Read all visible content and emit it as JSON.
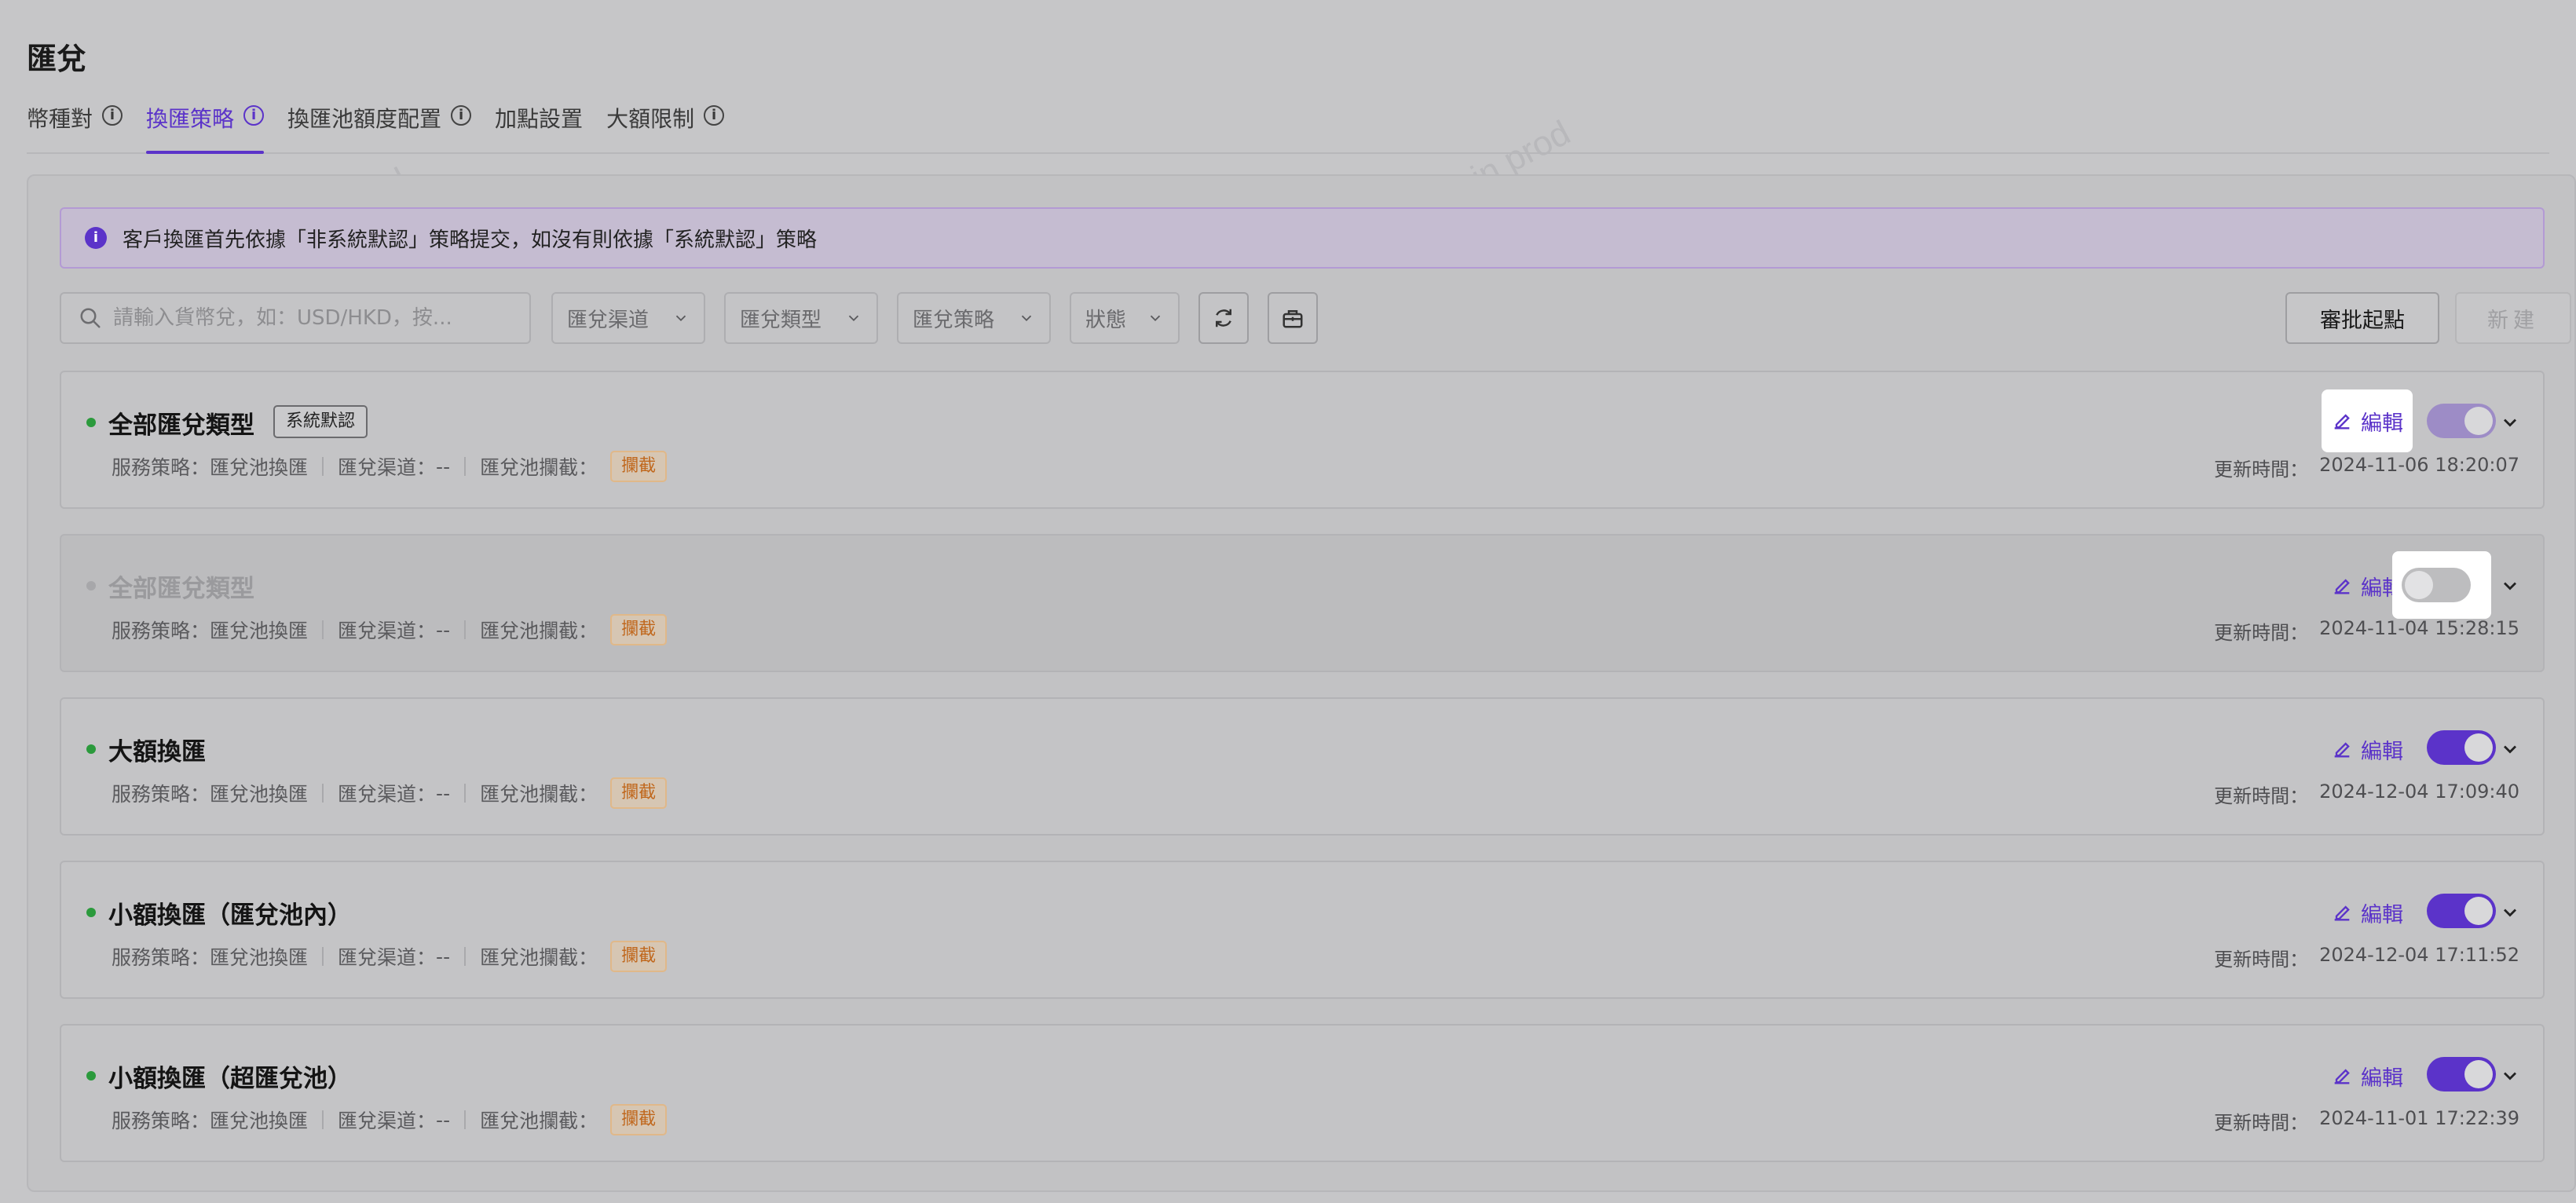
{
  "page": {
    "title": "匯兌"
  },
  "tabs": [
    {
      "label": "幣種對",
      "active": false
    },
    {
      "label": "換匯策略",
      "active": true
    },
    {
      "label": "換匯池額度配置",
      "active": false
    },
    {
      "label": "加點設置",
      "active": false
    },
    {
      "label": "大額限制",
      "active": false
    }
  ],
  "notice": {
    "text": "客戶換匯首先依據「非系統默認」策略提交，如沒有則依據「系統默認」策略"
  },
  "toolbar": {
    "search_placeholder": "請輸入貨幣兌，如：USD/HKD，按...",
    "filter_channel": "匯兌渠道",
    "filter_type": "匯兌類型",
    "filter_strategy": "匯兌策略",
    "filter_status": "狀態",
    "approve_label": "審批起點",
    "new_label": "新建"
  },
  "labels": {
    "strategy": "服務策略：",
    "channel": "匯兌渠道：",
    "intercept": "匯兌池攔截：",
    "updated": "更新時間：",
    "edit": "編輯"
  },
  "cards": [
    {
      "title": "全部匯兌類型",
      "badge": "系統默認",
      "strategy": "匯兌池換匯",
      "channel": "--",
      "intercept": "攔截",
      "updated": "2024-11-06 18:20:07",
      "enabled": true,
      "status": "active"
    },
    {
      "title": "全部匯兌類型",
      "badge": "",
      "strategy": "匯兌池換匯",
      "channel": "--",
      "intercept": "攔截",
      "updated": "2024-11-04 15:28:15",
      "enabled": false,
      "status": "inactive"
    },
    {
      "title": "大額換匯",
      "badge": "",
      "strategy": "匯兌池換匯",
      "channel": "--",
      "intercept": "攔截",
      "updated": "2024-12-04 17:09:40",
      "enabled": true,
      "status": "active"
    },
    {
      "title": "小額換匯（匯兌池內）",
      "badge": "",
      "strategy": "匯兌池換匯",
      "channel": "--",
      "intercept": "攔截",
      "updated": "2024-12-04 17:11:52",
      "enabled": true,
      "status": "active"
    },
    {
      "title": "小額換匯（超匯兌池）",
      "badge": "",
      "strategy": "匯兌池換匯",
      "channel": "--",
      "intercept": "攔截",
      "updated": "2024-11-01 17:22:39",
      "enabled": true,
      "status": "active"
    }
  ],
  "watermark": "LongPort Test Admin prod",
  "colors": {
    "accent": "#5b33c9",
    "active_dot": "#2b9a3c",
    "intercept": "#c0671c"
  }
}
